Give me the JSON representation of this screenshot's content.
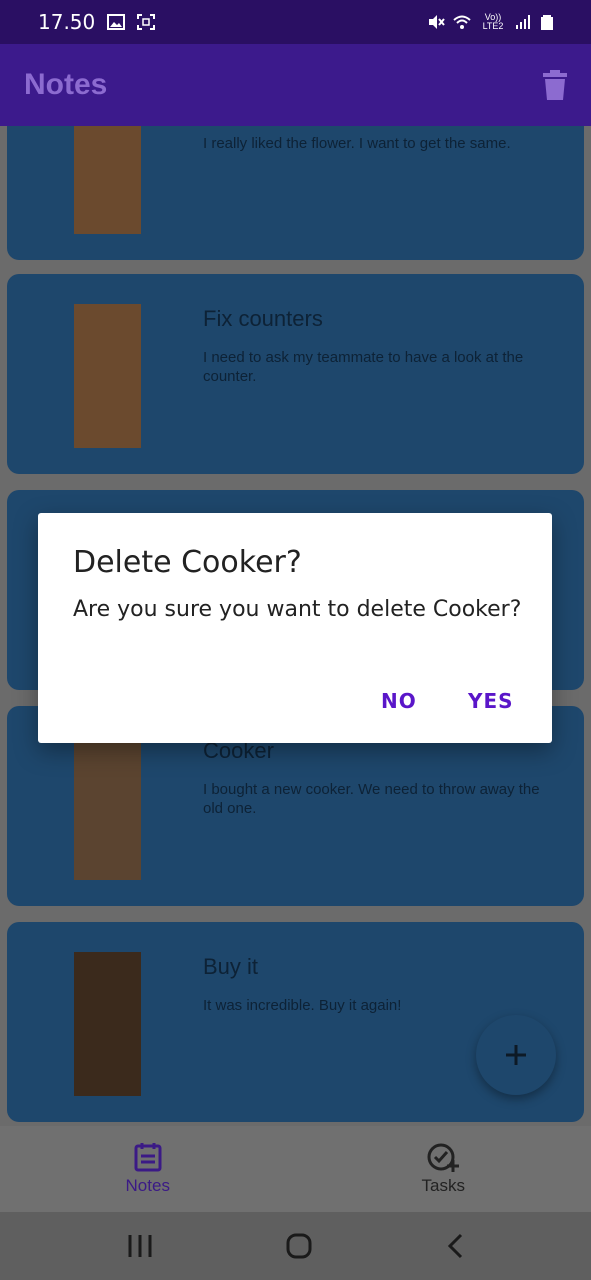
{
  "status": {
    "time": "17.50",
    "network_label": "Vo)) LTE2"
  },
  "app_bar": {
    "title": "Notes"
  },
  "notes": [
    {
      "title": "",
      "body": "I really liked the flower. I want to get the same."
    },
    {
      "title": "Fix counters",
      "body": "I need to ask my teammate to have a look at the counter."
    },
    {
      "title": "",
      "body": ""
    },
    {
      "title": "Cooker",
      "body": "I bought a new cooker. We need to throw away the old one."
    },
    {
      "title": "Buy it",
      "body": "It was incredible. Buy it again!"
    }
  ],
  "bottom_nav": {
    "notes_label": "Notes",
    "tasks_label": "Tasks"
  },
  "dialog": {
    "title": "Delete Cooker?",
    "message": "Are you sure you want to delete Cooker?",
    "no_label": "NO",
    "yes_label": "YES"
  },
  "colors": {
    "status_bar": "#2a0f63",
    "app_bar": "#3c1a8c",
    "card": "#1e476c",
    "accent": "#5a16c9"
  }
}
